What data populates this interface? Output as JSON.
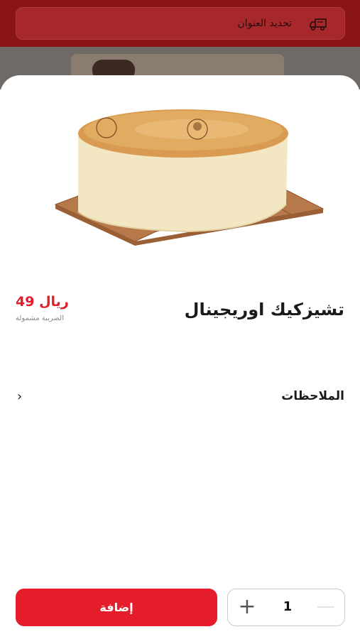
{
  "header": {
    "address_label": "تحديد العنوان",
    "truck_icon": "delivery-truck-icon"
  },
  "product": {
    "title": "تشيزكيك اوريجينال",
    "price": "49 ريال",
    "tax_note": "الضريبة مشمولة",
    "image_icon": "cheesecake-image"
  },
  "notes": {
    "label": "الملاحظات",
    "chevron": "›"
  },
  "cart": {
    "add_label": "إضافة",
    "quantity": "1",
    "plus": "+"
  },
  "colors": {
    "accent": "#e51d2b",
    "header": "#8b1416"
  }
}
